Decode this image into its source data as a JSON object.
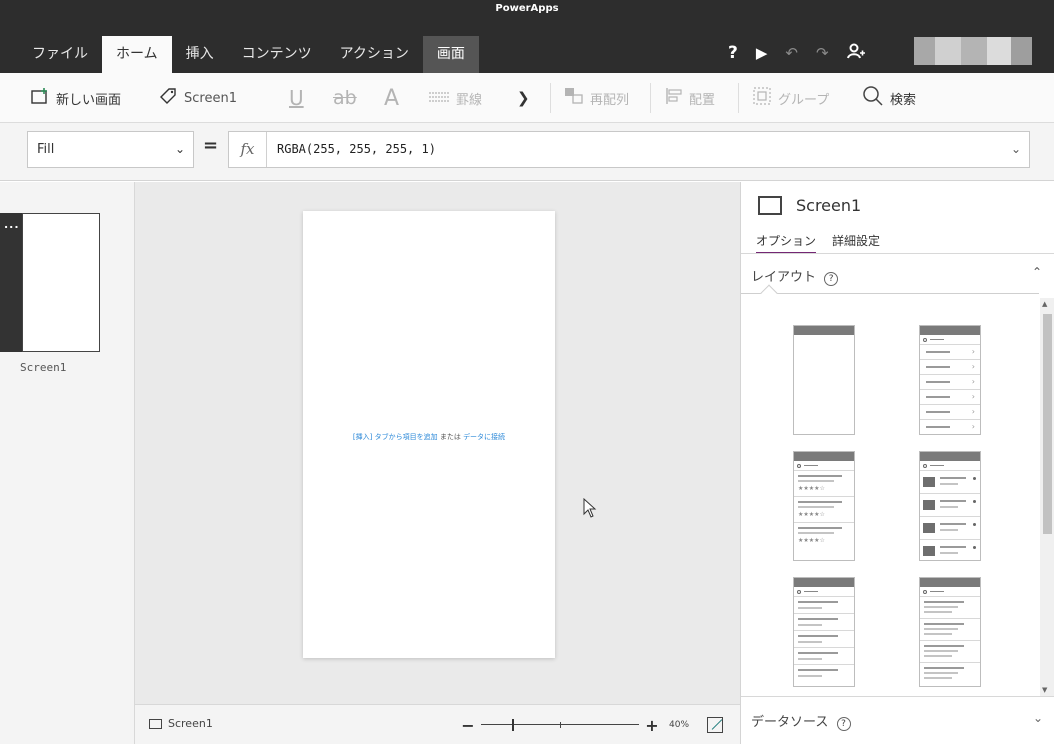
{
  "app": {
    "title": "PowerApps"
  },
  "tabs": [
    {
      "label": "ファイル",
      "state": "normal"
    },
    {
      "label": "ホーム",
      "state": "active"
    },
    {
      "label": "挿入",
      "state": "normal"
    },
    {
      "label": "コンテンツ",
      "state": "normal"
    },
    {
      "label": "アクション",
      "state": "normal"
    },
    {
      "label": "画面",
      "state": "context"
    }
  ],
  "toolbar_icons": [
    "help-icon",
    "play-icon",
    "undo-icon",
    "redo-icon",
    "account-icon"
  ],
  "toolbar_help": "?",
  "ribbon": {
    "new_screen": "新しい画面",
    "screen_name": "Screen1",
    "underline": "U",
    "strike": "ab",
    "font": "A",
    "border": "罫線",
    "reorder": "再配列",
    "align": "配置",
    "group": "グループ",
    "search": "検索"
  },
  "formula": {
    "property": "Fill",
    "equals": "=",
    "fx": "fx",
    "value": "RGBA(255, 255, 255, 1)"
  },
  "screens": [
    {
      "name": "Screen1",
      "menu": "..."
    }
  ],
  "canvas": {
    "hint_insert": "[挿入] タブから項目を追加",
    "hint_or": " または ",
    "hint_data": "データに接続"
  },
  "status": {
    "screen": "Screen1",
    "zoom_minus": "−",
    "zoom_plus": "+",
    "zoom_value": "40%",
    "zoom_percent": 40
  },
  "properties": {
    "title": "Screen1",
    "tabs": [
      {
        "label": "オプション",
        "active": true
      },
      {
        "label": "詳細設定",
        "active": false
      }
    ],
    "layout_section": "レイアウト",
    "data_section": "データソース",
    "help_glyph": "?"
  },
  "colors": {
    "topbar": "#2d2d2d",
    "active_tab_underline": "#742774",
    "link": "#2b88d8"
  }
}
